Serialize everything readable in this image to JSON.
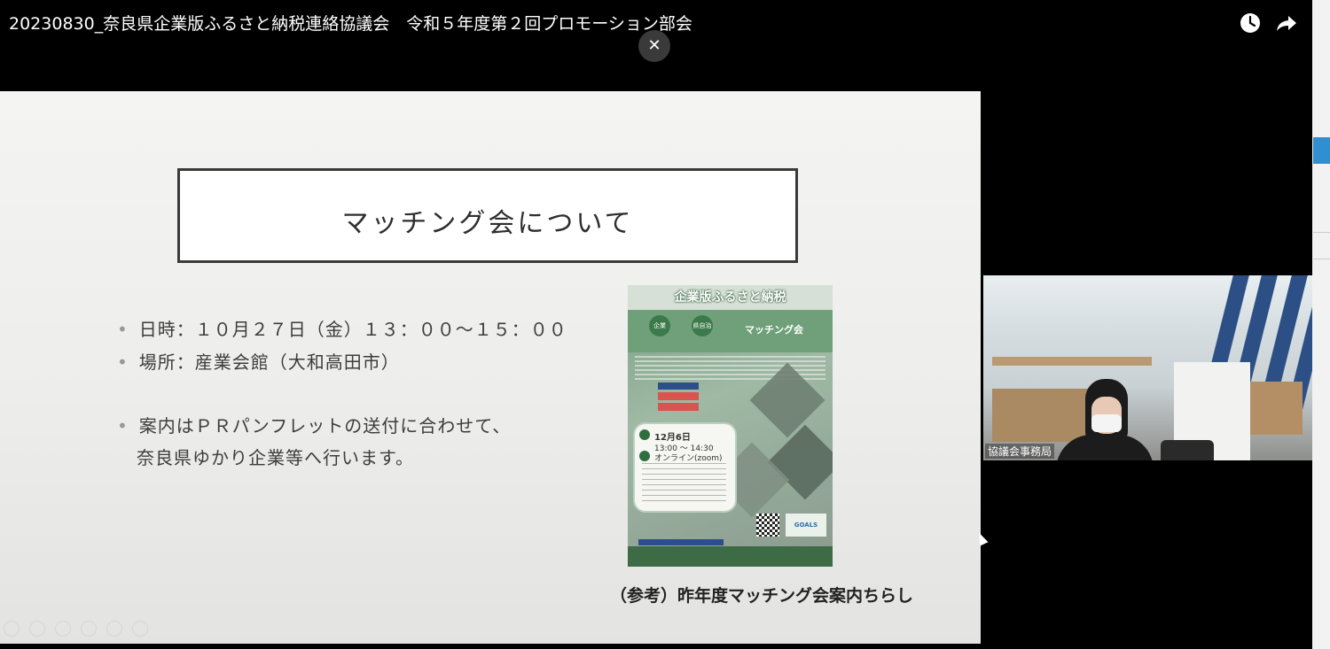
{
  "header": {
    "video_title": "20230830_奈良県企業版ふるさと納税連絡協議会　令和５年度第２回プロモーション部会",
    "close_label": "✕"
  },
  "slide": {
    "title": "マッチング会について",
    "bullets": [
      "日時：１０月２７日（金）１３：００～１５：００",
      "場所：産業会館（大和高田市）",
      "案内はＰＲパンフレットの送付に合わせて、"
    ],
    "bullet3_cont": "奈良県ゆかり企業等へ行います。",
    "flyer": {
      "title": "企業版ふるさと納税",
      "match": "マッチング会",
      "circle_a": "企業",
      "circle_b": "県自治",
      "date": "12月6日",
      "time": "13:00 ～ 14:30",
      "online": "オンライン(zoom)",
      "goals": "GOALS"
    },
    "caption": "（参考）昨年度マッチング会案内ちらし"
  },
  "webcam": {
    "participant_name": "協議会事務局"
  },
  "icons": [
    "clock-icon",
    "share-icon",
    "close-icon"
  ]
}
